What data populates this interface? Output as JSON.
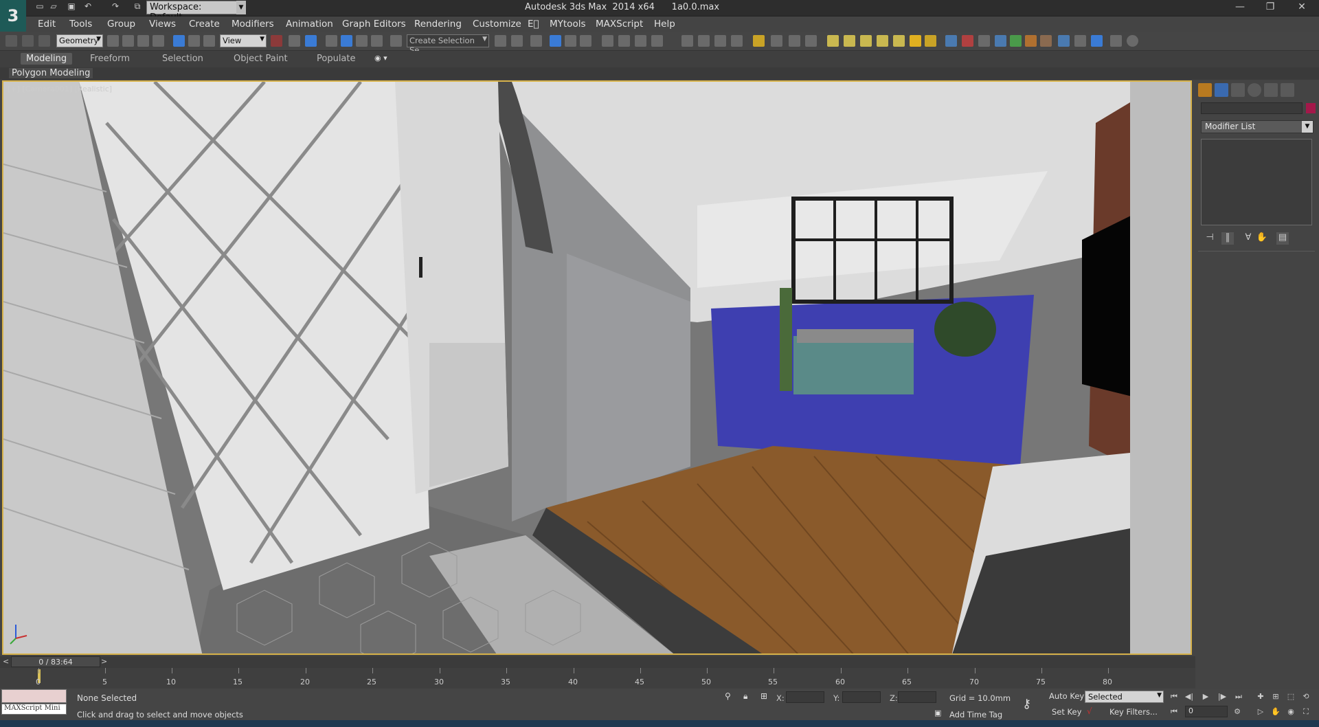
{
  "titlebar": {
    "workspace_label": "Workspace: Default",
    "app_title": "Autodesk 3ds Max  2014 x64      1a0.0.max",
    "logo_glyph": "3"
  },
  "menu": {
    "items": [
      "Edit",
      "Tools",
      "Group",
      "Views",
      "Create",
      "Modifiers",
      "Animation",
      "Graph Editors",
      "Rendering",
      "Customize",
      "MYtools",
      "MAXScript",
      "Help"
    ],
    "e_icon": "E⃝"
  },
  "toolbar": {
    "selection_filter": "Geometry",
    "reference_coord": "View",
    "named_selection_placeholder": "Create Selection Se"
  },
  "ribbon": {
    "tabs": [
      "Modeling",
      "Freeform",
      "Selection",
      "Object Paint",
      "Populate"
    ],
    "active_tab": "Modeling",
    "panel_label": "Polygon Modeling"
  },
  "viewport": {
    "label": "[+] [Camera001] [Realistic]"
  },
  "command_panel": {
    "modifier_list": "Modifier List",
    "swatch_color": "#a4184a"
  },
  "timeslider": {
    "frame_readout": "0 / 83:64",
    "prev": "<",
    "next": ">"
  },
  "trackbar": {
    "ticks": [
      "0",
      "5",
      "10",
      "15",
      "20",
      "25",
      "30",
      "35",
      "40",
      "45",
      "50",
      "55",
      "60",
      "65",
      "70",
      "75",
      "80"
    ]
  },
  "status": {
    "maxscript_mini": "MAXScript Mini",
    "selection_status": "None Selected",
    "prompt": "Click and drag to select and move objects",
    "x_label": "X:",
    "y_label": "Y:",
    "z_label": "Z:",
    "grid": "Grid = 10.0mm",
    "add_time_tag": "Add Time Tag",
    "auto_key": "Auto Key",
    "set_key": "Set Key",
    "key_filters": "Key Filters...",
    "selected": "Selected",
    "frame_value": "0"
  }
}
